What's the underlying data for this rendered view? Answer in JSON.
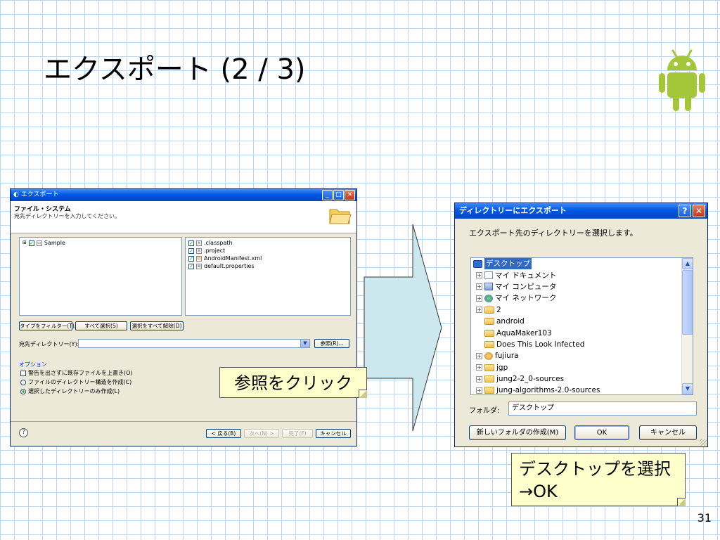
{
  "slide": {
    "title": "エクスポート (2 / 3)",
    "page_number": "31"
  },
  "eclipse_dialog": {
    "title": "エクスポート",
    "heading": "ファイル・システム",
    "description": "宛先ディレクトリーを入力してください。",
    "tree_item": "Sample",
    "files": [
      ".classpath",
      ".project",
      "AndroidManifest.xml",
      "default.properties"
    ],
    "buttons": {
      "filter_types": "タイプをフィルター(T)...",
      "select_all": "すべて選択(S)",
      "deselect_all": "選択をすべて解除(D)",
      "browse": "参照(R)...",
      "back": "< 戻る(B)",
      "next": "次へ(N) >",
      "finish": "完了(F)",
      "cancel": "キャンセル"
    },
    "dest_dir_label": "宛先ディレクトリー(Y):",
    "dest_dir_value": "",
    "options_label": "オプション",
    "options": [
      {
        "label": "警告を出さずに既存ファイルを上書き(O)",
        "type": "checkbox",
        "checked": false
      },
      {
        "label": "ファイルのディレクトリー構造を作成(C)",
        "type": "radio",
        "checked": false
      },
      {
        "label": "選択したディレクトリーのみ作成(L)",
        "type": "radio",
        "checked": true
      }
    ]
  },
  "directory_dialog": {
    "title": "ディレクトリーにエクスポート",
    "instruction": "エクスポート先のディレクトリーを選択します。",
    "tree": [
      {
        "label": "デスクトップ",
        "selected": true,
        "expander": "",
        "icon": "desktop-icon"
      },
      {
        "label": "マイ ドキュメント",
        "expander": "+",
        "icon": "documents-icon"
      },
      {
        "label": "マイ コンピュータ",
        "expander": "+",
        "icon": "computer-icon"
      },
      {
        "label": "マイ ネットワーク",
        "expander": "+",
        "icon": "network-icon"
      },
      {
        "label": "2",
        "expander": "+",
        "icon": "folder-icon"
      },
      {
        "label": "android",
        "expander": "",
        "icon": "folder-icon"
      },
      {
        "label": "AquaMaker103",
        "expander": "",
        "icon": "folder-icon"
      },
      {
        "label": "Does This Look Infected",
        "expander": "",
        "icon": "folder-icon"
      },
      {
        "label": "fujiura",
        "expander": "+",
        "icon": "user-folder-icon"
      },
      {
        "label": "jgp",
        "expander": "+",
        "icon": "folder-icon"
      },
      {
        "label": "jung2-2_0-sources",
        "expander": "+",
        "icon": "folder-icon"
      },
      {
        "label": "jung-algorithms-2.0-sources",
        "expander": "+",
        "icon": "folder-icon"
      }
    ],
    "folder_label": "フォルダ:",
    "folder_value": "デスクトップ",
    "buttons": {
      "new_folder": "新しいフォルダの作成(M)",
      "ok": "OK",
      "cancel": "キャンセル"
    }
  },
  "callouts": {
    "browse_hint": "参照をクリック",
    "select_line1": "デスクトップを選択",
    "select_line2": "→OK"
  },
  "colors": {
    "android_green": "#a4c639",
    "arrow_fill": "#cce8ee",
    "callout_bg": "#ffffcc",
    "xp_title": "#0058e6"
  }
}
